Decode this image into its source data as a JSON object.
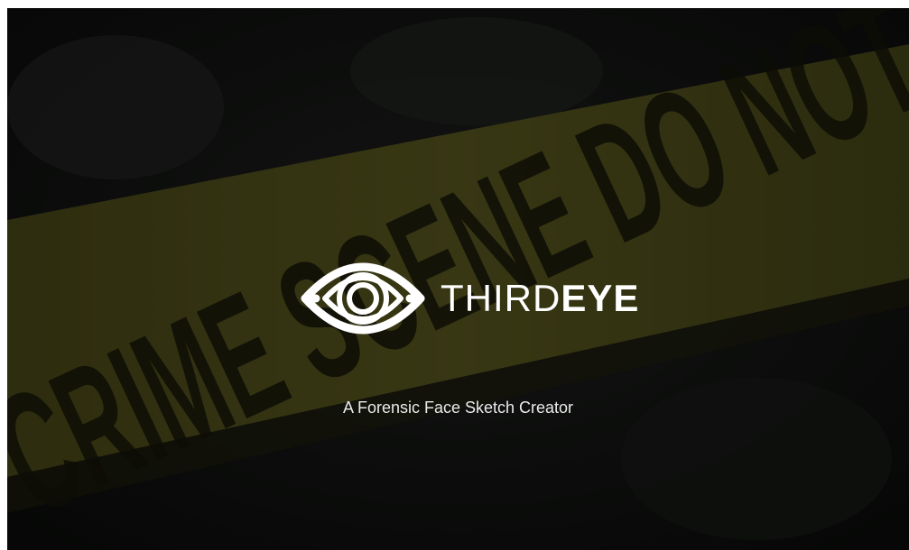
{
  "background": {
    "description_icon": "crime-scene-tape-icon",
    "tape_text": "CRIME SCENE DO NOT",
    "tape_color": "#4a4a1a",
    "base_color": "#0f1110"
  },
  "brand": {
    "logo_icon": "eye-logo-icon",
    "name_light": "THIRD",
    "name_bold": "EYE",
    "text_color": "#ffffff"
  },
  "tagline": "A Forensic Face Sketch Creator"
}
